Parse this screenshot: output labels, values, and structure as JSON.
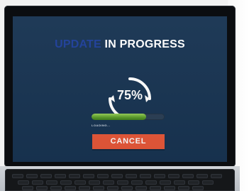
{
  "screen": {
    "title_prefix": "UPDATE",
    "title_suffix": " IN PROGRESS",
    "percent_text": "75%",
    "progress_fraction": 0.75,
    "loading_label": "LOADING...",
    "cancel_label": "CANCEL"
  },
  "colors": {
    "screen_background": "#183452",
    "progress_green": "#6cb53a",
    "cancel_button": "#e85839",
    "title_prefix": "#1e3f9a",
    "title_suffix": "#ffffff"
  },
  "icons": {
    "refresh": "refresh-arrows-icon"
  }
}
